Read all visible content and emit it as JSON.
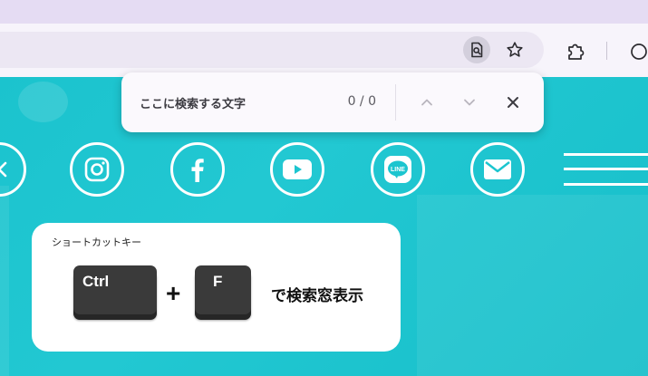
{
  "find_bar": {
    "placeholder": "ここに検索する文字",
    "match_count": "0 / 0",
    "prev_icon": "chevron-up-icon",
    "next_icon": "chevron-down-icon",
    "close_icon": "close-icon"
  },
  "toolbar": {
    "find_icon": "find-in-page-icon",
    "bookmark_icon": "star-icon",
    "extensions_icon": "puzzle-icon"
  },
  "social_icons": [
    "x-icon",
    "instagram-icon",
    "facebook-icon",
    "youtube-icon",
    "line-icon",
    "mail-icon"
  ],
  "line_label": "LINE",
  "shortcut": {
    "title": "ショートカットキー",
    "key1": "Ctrl",
    "plus": "+",
    "key2": "F",
    "description": "で検索窓表示"
  },
  "colors": {
    "tabstrip": "#e5dcf3",
    "toolbar": "#f7f4fb",
    "page_bg": "#1cc5cf",
    "key": "#3a3a3a"
  }
}
